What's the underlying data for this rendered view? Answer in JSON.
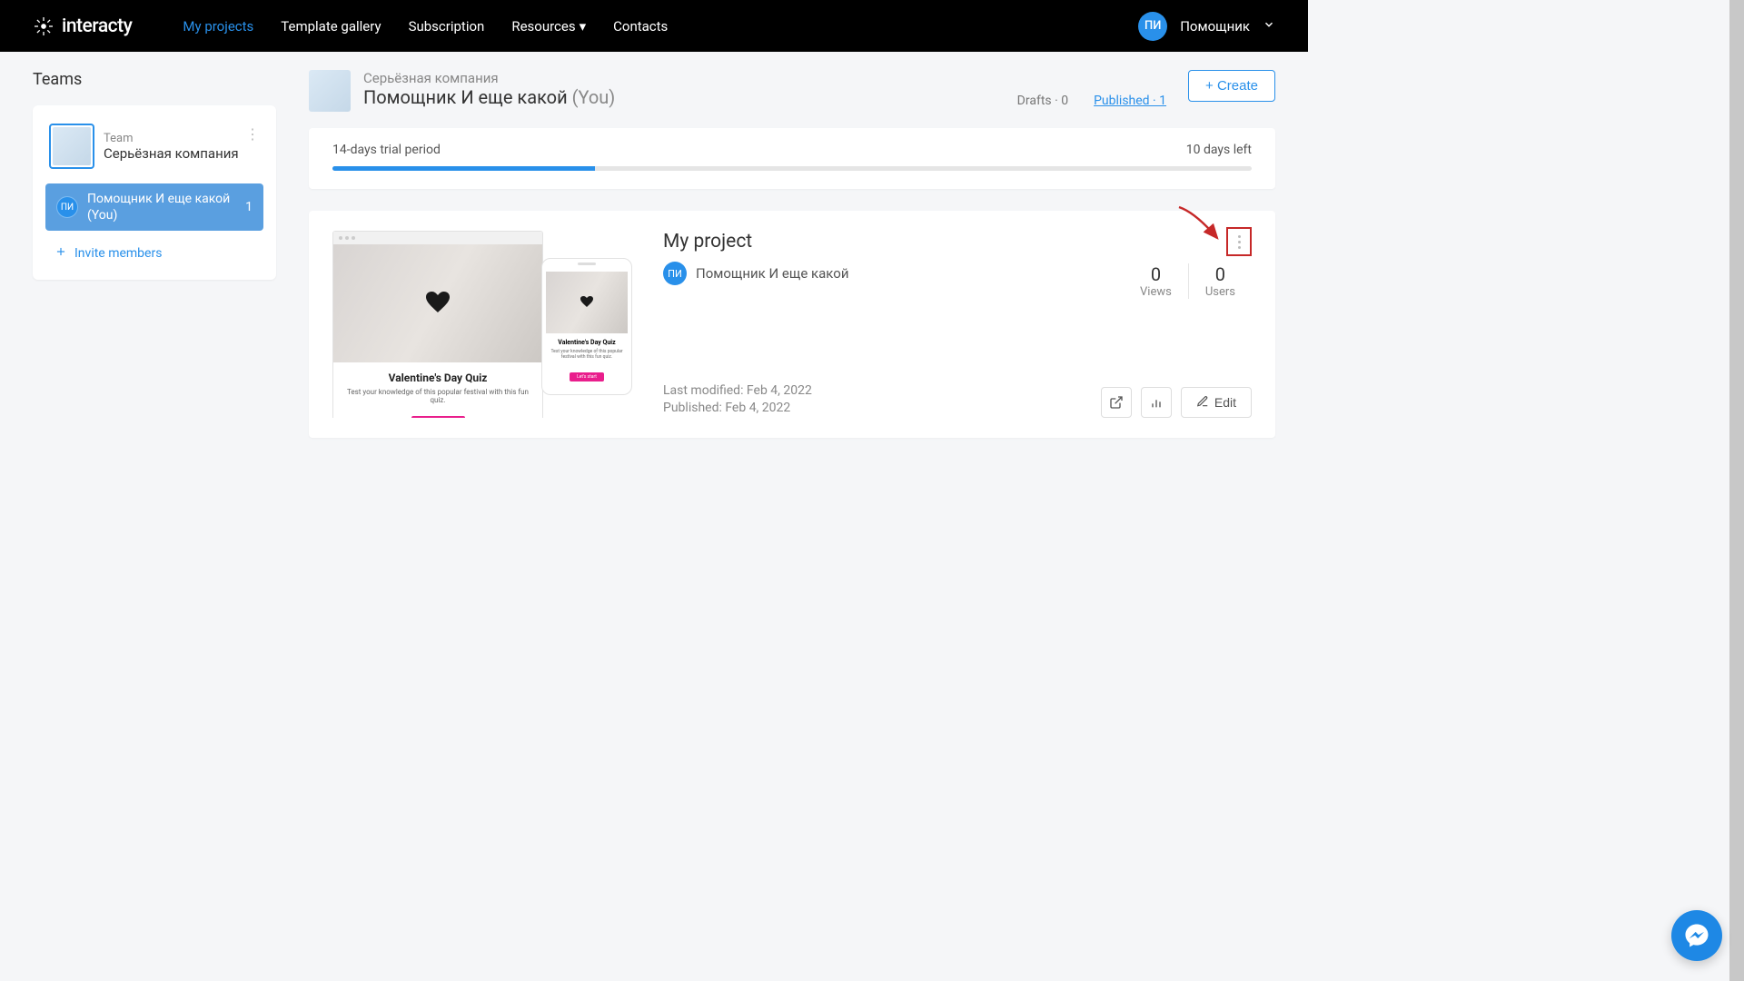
{
  "brand": "interacty",
  "nav": {
    "my_projects": "My projects",
    "template_gallery": "Template gallery",
    "subscription": "Subscription",
    "resources": "Resources",
    "contacts": "Contacts"
  },
  "user": {
    "initials": "ПИ",
    "name": "Помощник"
  },
  "sidebar": {
    "title": "Teams",
    "team_label": "Team",
    "team_name": "Серьёзная компания",
    "member_initials": "ПИ",
    "member_name": "Помощник И еще какой (You)",
    "member_count": "1",
    "invite": "Invite members"
  },
  "header": {
    "company": "Серьёзная компания",
    "title_main": "Помощник И еще какой",
    "title_you": "(You)",
    "drafts": "Drafts · 0",
    "published": "Published  · 1",
    "create": "+ Create"
  },
  "trial": {
    "label": "14-days trial period",
    "remaining": "10 days left"
  },
  "project": {
    "title": "My project",
    "author_initials": "ПИ",
    "author_name": "Помощник И еще какой",
    "last_modified": "Last modified: Feb 4, 2022",
    "published": "Published: Feb 4, 2022",
    "views_val": "0",
    "views_label": "Views",
    "users_val": "0",
    "users_label": "Users",
    "edit": "Edit",
    "mock_title": "Valentine's Day Quiz",
    "mock_sub": "Test your knowledge of this popular festival with this fun quiz.",
    "mock_btn": "Let's start"
  }
}
